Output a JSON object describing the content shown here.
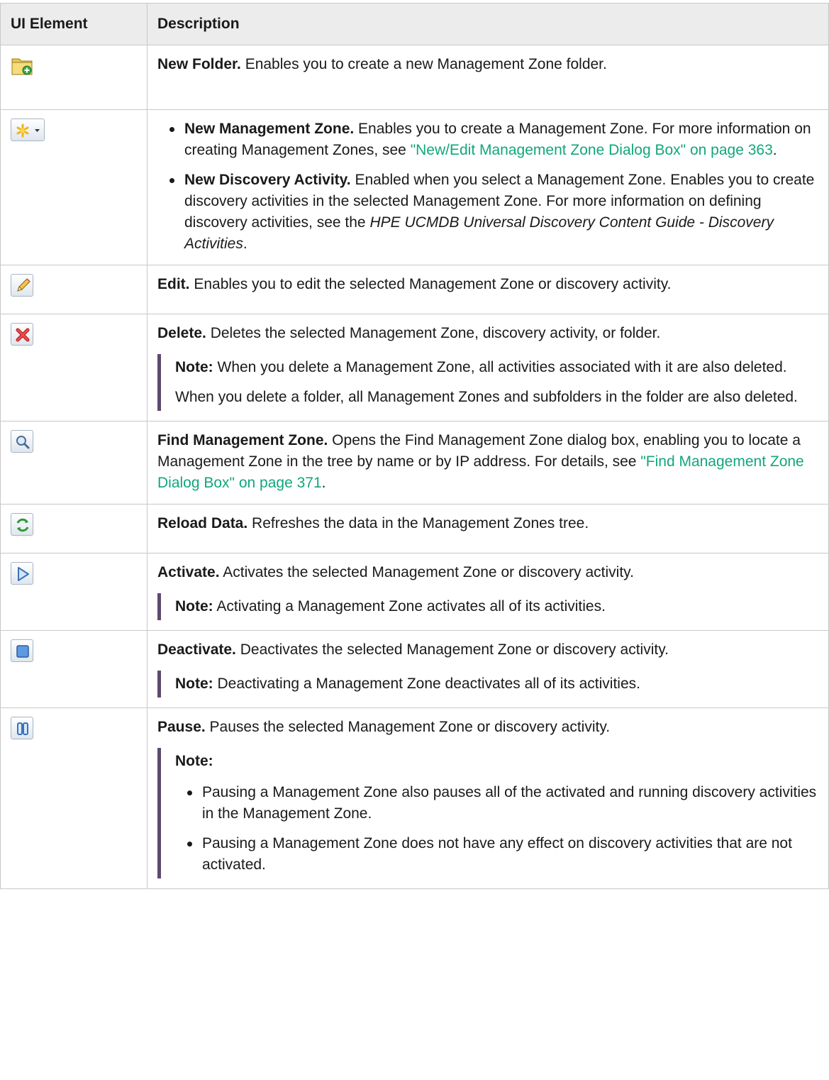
{
  "table": {
    "header": {
      "col1": "UI Element",
      "col2": "Description"
    },
    "rows": {
      "new_folder": {
        "title": "New Folder.",
        "text": " Enables you to create a new Management Zone folder."
      },
      "new_menu": {
        "item1": {
          "title": "New Management Zone.",
          "text": " Enables you to create a Management Zone. For more information on creating Management Zones, see ",
          "link": "\"New/Edit Management Zone Dialog Box\" on page 363",
          "after": "."
        },
        "item2": {
          "title": "New Discovery Activity.",
          "text": " Enabled when you select a Management Zone. Enables you to create discovery activities in the selected Management Zone. For more information on defining discovery activities, see the ",
          "em": "HPE UCMDB Universal Discovery Content Guide - Discovery Activities",
          "after": "."
        }
      },
      "edit": {
        "title": "Edit.",
        "text": " Enables you to edit the selected Management Zone or discovery activity."
      },
      "delete": {
        "title": "Delete.",
        "text": " Deletes the selected Management Zone, discovery activity, or folder.",
        "note_label": "Note:",
        "note_text": "  When you delete a Management Zone, all activities associated with it are also deleted.",
        "note_text2": "When you delete a folder, all Management Zones and subfolders in the folder are also deleted."
      },
      "find": {
        "title": "Find Management Zone.",
        "text": " Opens the Find Management Zone dialog box, enabling you to locate a Management Zone in the tree by name or by IP address. For details, see ",
        "link": "\"Find Management Zone Dialog Box\" on page 371",
        "after": "."
      },
      "reload": {
        "title": "Reload Data.",
        "text": " Refreshes the data in the Management Zones tree."
      },
      "activate": {
        "title": "Activate.",
        "text": " Activates the selected Management Zone or discovery activity.",
        "note_label": "Note:",
        "note_text": "  Activating a Management Zone activates all of its activities."
      },
      "deactivate": {
        "title": "Deactivate.",
        "text": " Deactivates the selected Management Zone or discovery activity.",
        "note_label": "Note:",
        "note_text": "  Deactivating a Management Zone deactivates all of its activities."
      },
      "pause": {
        "title": "Pause.",
        "text": " Pauses the selected Management Zone or discovery activity.",
        "note_label": "Note:",
        "bullet1": "Pausing a Management Zone also pauses all of the activated and running discovery activities in the Management Zone.",
        "bullet2": "Pausing a Management Zone does not have any effect on discovery activities that are not activated."
      }
    }
  },
  "icons": {
    "new_folder": "new-folder-icon",
    "new_menu": "new-asterisk-dropdown-icon",
    "edit": "pencil-icon",
    "delete": "red-x-icon",
    "find": "magnifier-icon",
    "reload": "green-refresh-icon",
    "activate": "play-icon",
    "deactivate": "stop-icon",
    "pause": "pause-icon"
  },
  "colors": {
    "link": "#11a77b",
    "note_bar": "#5d4a6e",
    "header_bg": "#ececec",
    "border": "#c8c8c8"
  }
}
